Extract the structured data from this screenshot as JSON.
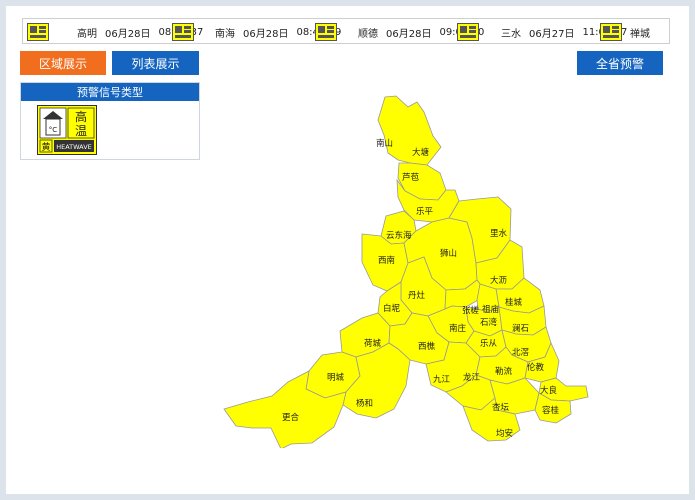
{
  "ticker": {
    "items": [
      {
        "location": "",
        "date": "",
        "time": ""
      },
      {
        "location": "高明",
        "date": "06月28日",
        "time": "08:51:37"
      },
      {
        "location": "南海",
        "date": "06月28日",
        "time": "08:40:29"
      },
      {
        "location": "顺德",
        "date": "06月28日",
        "time": "09:07:00"
      },
      {
        "location": "三水",
        "date": "06月27日",
        "time": "11:00:47"
      },
      {
        "location": "禅城",
        "date": "",
        "time": ""
      }
    ]
  },
  "buttons": {
    "area_view": "区域展示",
    "list_view": "列表展示",
    "province_warning": "全省预警"
  },
  "legend": {
    "title": "预警信号类型",
    "signal": {
      "line1": "高",
      "line2": "温",
      "level": "黄",
      "english": "HEATWAVE",
      "unit": "°C"
    }
  },
  "colors": {
    "warning_yellow": "#ffff00",
    "accent_orange": "#f26e1f",
    "accent_blue": "#1565c0",
    "border_gray": "#b0b0b0"
  },
  "map": {
    "regions": [
      "南山",
      "大塘",
      "芦苞",
      "乐平",
      "云东海",
      "西南",
      "狮山",
      "里水",
      "大沥",
      "丹灶",
      "白坭",
      "桂城",
      "张槎",
      "祖庙",
      "石湾",
      "南庄",
      "澜石",
      "南庄",
      "荷城",
      "西樵",
      "乐从",
      "北滘",
      "明城",
      "九江",
      "勒流",
      "伦教",
      "大良",
      "杨和",
      "更合",
      "龙江",
      "杏坛",
      "容桂",
      "均安"
    ]
  }
}
